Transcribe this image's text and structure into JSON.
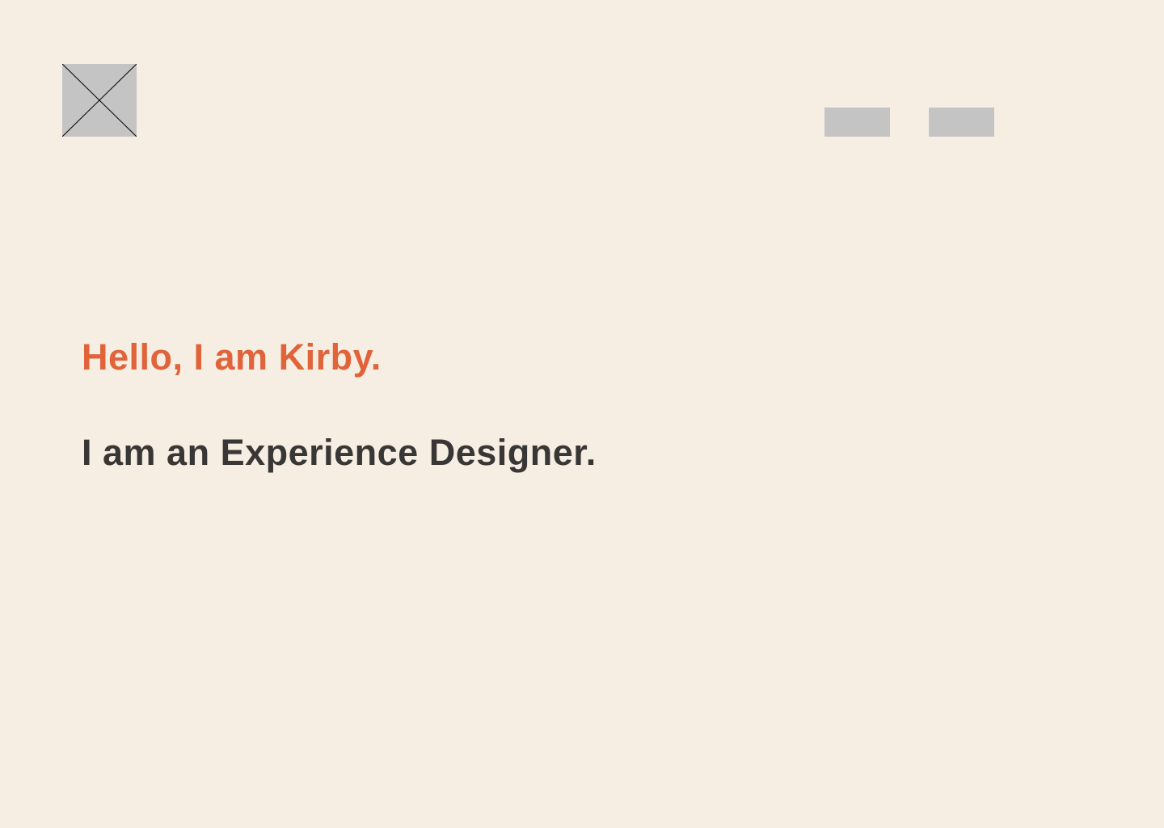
{
  "theme": {
    "background": "#F6EEE3",
    "placeholder_fill": "#C4C4C4",
    "accent": "#E0633A",
    "text": "#393735"
  },
  "header": {
    "logo_icon": "image-placeholder-icon",
    "nav_items": [
      "",
      ""
    ]
  },
  "hero": {
    "greeting": "Hello, I am Kirby.",
    "role": "I am an Experience Designer."
  }
}
